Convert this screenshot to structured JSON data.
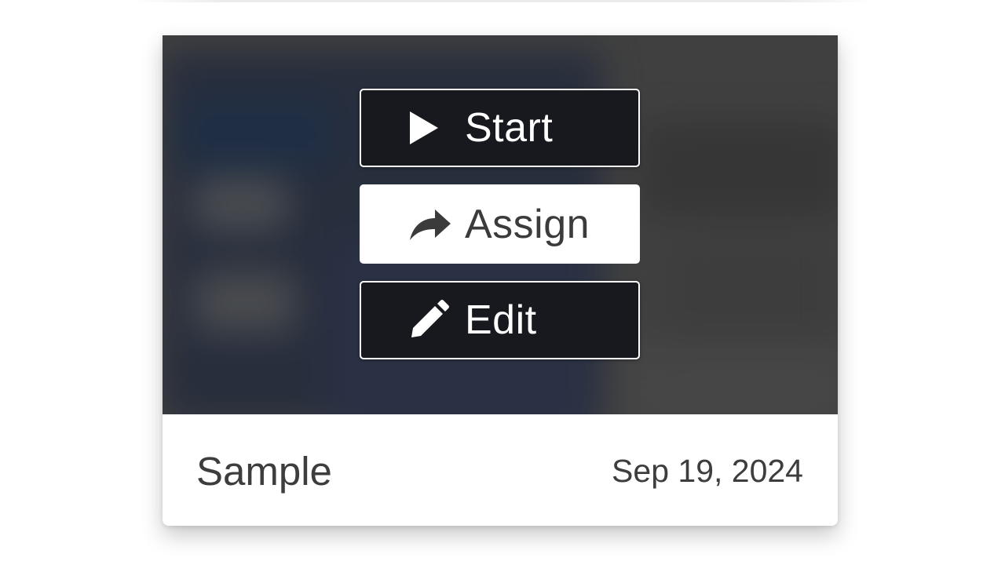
{
  "card": {
    "title": "Sample",
    "date": "Sep 19, 2024"
  },
  "actions": {
    "start": {
      "label": "Start",
      "icon": "play-icon"
    },
    "assign": {
      "label": "Assign",
      "icon": "share-arrow-icon"
    },
    "edit": {
      "label": "Edit",
      "icon": "pencil-icon"
    }
  },
  "colors": {
    "dark_button": "#17191e",
    "light_button": "#ffffff",
    "thumbnail_bg": "#4a4a4a",
    "text": "#3d3d3d"
  }
}
